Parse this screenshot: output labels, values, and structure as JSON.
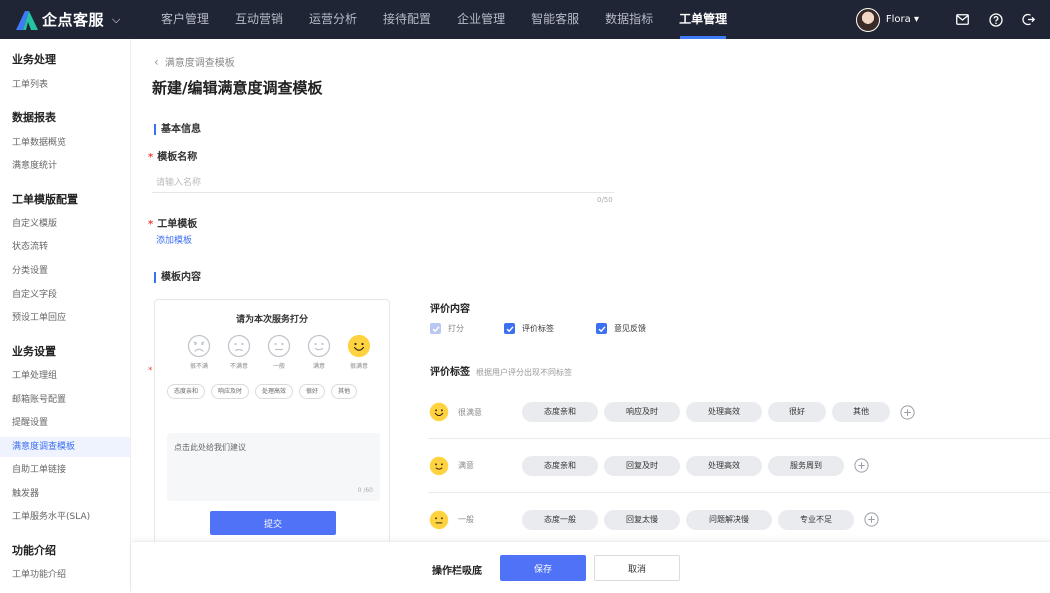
{
  "app": {
    "name": "企点客服",
    "user": "Flora",
    "accent": "#3d6ff2"
  },
  "nav": {
    "items": [
      {
        "label": "客户管理"
      },
      {
        "label": "互动营销"
      },
      {
        "label": "运营分析"
      },
      {
        "label": "接待配置"
      },
      {
        "label": "企业管理"
      },
      {
        "label": "智能客服"
      },
      {
        "label": "数据指标"
      },
      {
        "label": "工单管理"
      }
    ],
    "active": "工单管理"
  },
  "sidebar": {
    "groups": [
      {
        "title": "业务处理",
        "items": [
          "工单列表"
        ]
      },
      {
        "title": "数据报表",
        "items": [
          "工单数据概览",
          "满意度统计"
        ]
      },
      {
        "title": "工单模版配置",
        "items": [
          "自定义模版",
          "状态流转",
          "分类设置",
          "自定义字段",
          "预设工单回应"
        ]
      },
      {
        "title": "业务设置",
        "items": [
          "工单处理组",
          "邮箱账号配置",
          "提醒设置",
          "满意度调查模板",
          "自助工单链接",
          "触发器",
          "工单服务水平(SLA)"
        ]
      },
      {
        "title": "功能介绍",
        "items": [
          "工单功能介绍"
        ]
      }
    ],
    "active": "满意度调查模板"
  },
  "page": {
    "breadcrumb": "满意度调查模板",
    "title": "新建/编辑满意度调查模板",
    "basic_section": "基本信息",
    "name_label": "模板名称",
    "name_placeholder": "请输入名称",
    "name_value": "",
    "name_counter": "0/50",
    "ticket_label": "工单模板",
    "add_template_link": "添加模板",
    "content_section": "模板内容"
  },
  "preview": {
    "title": "请为本次服务打分",
    "faces": [
      "很不满",
      "不满意",
      "一般",
      "满意",
      "很满意"
    ],
    "selected_face": 4,
    "tags": [
      "态度亲和",
      "响应及时",
      "处理高效",
      "很好",
      "其他"
    ],
    "suggest_placeholder": "点击此处给我们建议",
    "suggest_counter": "0 /60",
    "submit_label": "提交"
  },
  "config": {
    "content_title": "评价内容",
    "options": [
      {
        "label": "打分",
        "checked": true,
        "disabled": true
      },
      {
        "label": "评价标签",
        "checked": true,
        "disabled": false
      },
      {
        "label": "意见反馈",
        "checked": true,
        "disabled": false
      }
    ],
    "tags_title": "评价标签",
    "tags_hint": "根据用户评分出现不同标签",
    "levels": [
      {
        "label": "很满意",
        "chips": [
          "态度亲和",
          "响应及时",
          "处理高效",
          "很好",
          "其他"
        ]
      },
      {
        "label": "满意",
        "chips": [
          "态度亲和",
          "回复及时",
          "处理高效",
          "服务周到"
        ]
      },
      {
        "label": "一般",
        "chips": [
          "态度一般",
          "回复太慢",
          "问题解决慢",
          "专业不足"
        ]
      }
    ]
  },
  "actions": {
    "bar_label": "操作栏吸底",
    "save_label": "保存",
    "cancel_label": "取消"
  }
}
